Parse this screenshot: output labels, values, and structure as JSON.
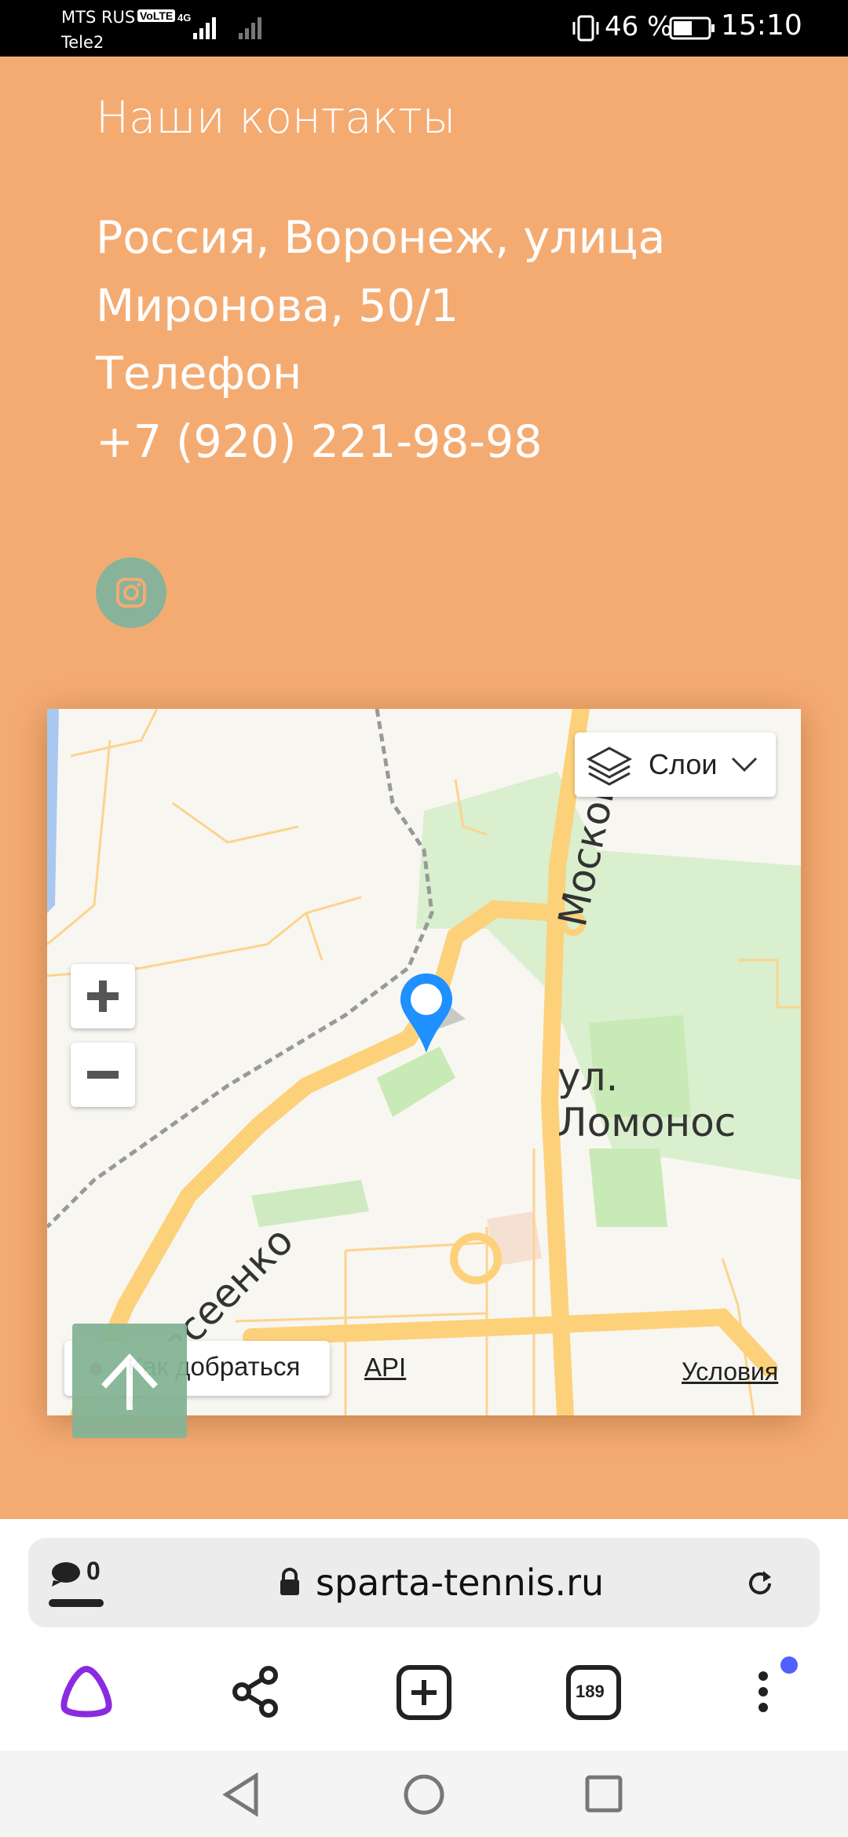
{
  "status_bar": {
    "carrier_primary": "MTS RUS",
    "volte": "VoLTE",
    "network": "4G",
    "carrier_secondary": "Tele2",
    "battery_percent": "46 %",
    "time": "15:10"
  },
  "contacts": {
    "title": "Наши контакты",
    "address_line1": "Россия, Воронеж, улица",
    "address_line2": "Миронова, 50/1",
    "phone_label": "Телефон",
    "phone": "+7 (920) 221-98-98"
  },
  "map": {
    "layers_label": "Слои",
    "route_label": "Как добраться",
    "api_label": "API",
    "terms_label": "Условия",
    "street_labels": [
      "Московск",
      "ул. Ломонос",
      "я-Овсеенко"
    ],
    "zoom_in_label": "+",
    "zoom_out_label": "−"
  },
  "browser": {
    "comments_count": "0",
    "url": "sparta-tennis.ru",
    "tabs_count": "189"
  },
  "icons": {
    "instagram": "instagram-icon",
    "layers": "layers-icon",
    "pin": "map-pin-icon",
    "scroll_up": "arrow-up-icon",
    "lock": "lock-icon",
    "reload": "reload-icon",
    "alice": "alice-icon",
    "share": "share-icon",
    "new_tab": "new-tab-icon",
    "tabs": "tabs-icon",
    "menu": "more-vertical-icon"
  },
  "colors": {
    "page_background": "#f4ab72",
    "accent_green": "#88b39a",
    "pin_blue": "#1e90ff",
    "alice_purple": "#8a2be2",
    "notification_dot": "#5060ff"
  }
}
